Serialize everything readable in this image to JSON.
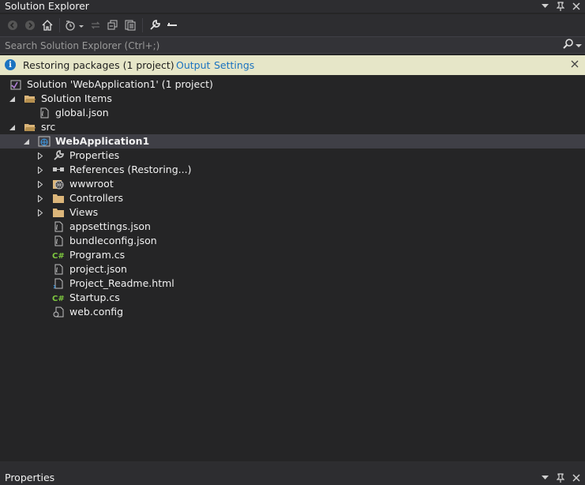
{
  "window": {
    "title": "Solution Explorer"
  },
  "search": {
    "placeholder": "Search Solution Explorer (Ctrl+;)"
  },
  "infobar": {
    "message": "Restoring packages (1 project)",
    "links": [
      "Output",
      "Settings"
    ]
  },
  "tree": [
    {
      "label": "Solution 'WebApplication1' (1 project)",
      "icon": "solution-icon",
      "depth": 0,
      "arrow": ""
    },
    {
      "label": "Solution Items",
      "icon": "folder-open-icon",
      "depth": 0,
      "arrow": "expanded"
    },
    {
      "label": "global.json",
      "icon": "json-file-icon",
      "depth": 1,
      "arrow": ""
    },
    {
      "label": "src",
      "icon": "folder-open-icon",
      "depth": 0,
      "arrow": "expanded"
    },
    {
      "label": "WebApplication1",
      "icon": "web-project-icon",
      "depth": 1,
      "arrow": "expanded",
      "selected": true,
      "bold": true
    },
    {
      "label": "Properties",
      "icon": "wrench-icon",
      "depth": 2,
      "arrow": "collapsed"
    },
    {
      "label": "References (Restoring...)",
      "icon": "references-icon",
      "depth": 2,
      "arrow": "collapsed"
    },
    {
      "label": "wwwroot",
      "icon": "globe-icon",
      "depth": 2,
      "arrow": "collapsed"
    },
    {
      "label": "Controllers",
      "icon": "folder-icon",
      "depth": 2,
      "arrow": "collapsed"
    },
    {
      "label": "Views",
      "icon": "folder-icon",
      "depth": 2,
      "arrow": "collapsed"
    },
    {
      "label": "appsettings.json",
      "icon": "json-file-icon",
      "depth": 2,
      "arrow": ""
    },
    {
      "label": "bundleconfig.json",
      "icon": "json-file-icon",
      "depth": 2,
      "arrow": ""
    },
    {
      "label": "Program.cs",
      "icon": "csharp-file-icon",
      "depth": 2,
      "arrow": ""
    },
    {
      "label": "project.json",
      "icon": "json-file-icon",
      "depth": 2,
      "arrow": ""
    },
    {
      "label": "Project_Readme.html",
      "icon": "html-file-icon",
      "depth": 2,
      "arrow": ""
    },
    {
      "label": "Startup.cs",
      "icon": "csharp-file-icon",
      "depth": 2,
      "arrow": ""
    },
    {
      "label": "web.config",
      "icon": "config-file-icon",
      "depth": 2,
      "arrow": ""
    }
  ],
  "bottom_panel": {
    "title": "Properties"
  },
  "colors": {
    "background": "#252526",
    "toolbar": "#2d2d30",
    "infobar": "#e6e6c8",
    "accent": "#1b73c0",
    "selection": "#3f3f46",
    "folder": "#dcb67a",
    "csharp": "#7ec83f"
  }
}
